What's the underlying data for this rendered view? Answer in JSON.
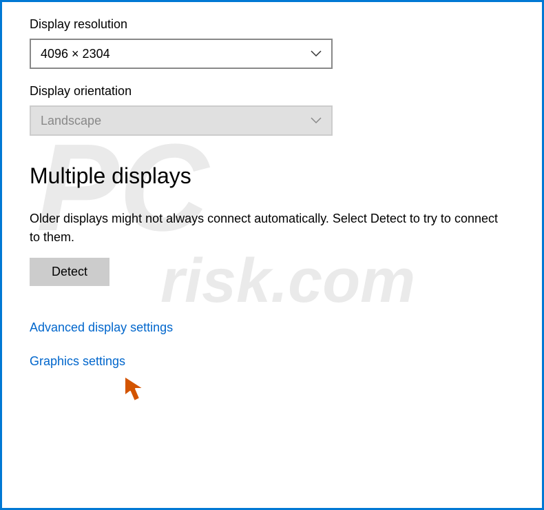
{
  "labels": {
    "resolution": "Display resolution",
    "orientation": "Display orientation"
  },
  "dropdowns": {
    "resolution_value": "4096 × 2304",
    "orientation_value": "Landscape"
  },
  "section": {
    "heading": "Multiple displays",
    "description": "Older displays might not always connect automatically. Select Detect to try to connect to them."
  },
  "buttons": {
    "detect": "Detect"
  },
  "links": {
    "advanced": "Advanced display settings",
    "graphics": "Graphics settings"
  },
  "watermark": {
    "pc": "PC",
    "risk": "risk.com"
  }
}
